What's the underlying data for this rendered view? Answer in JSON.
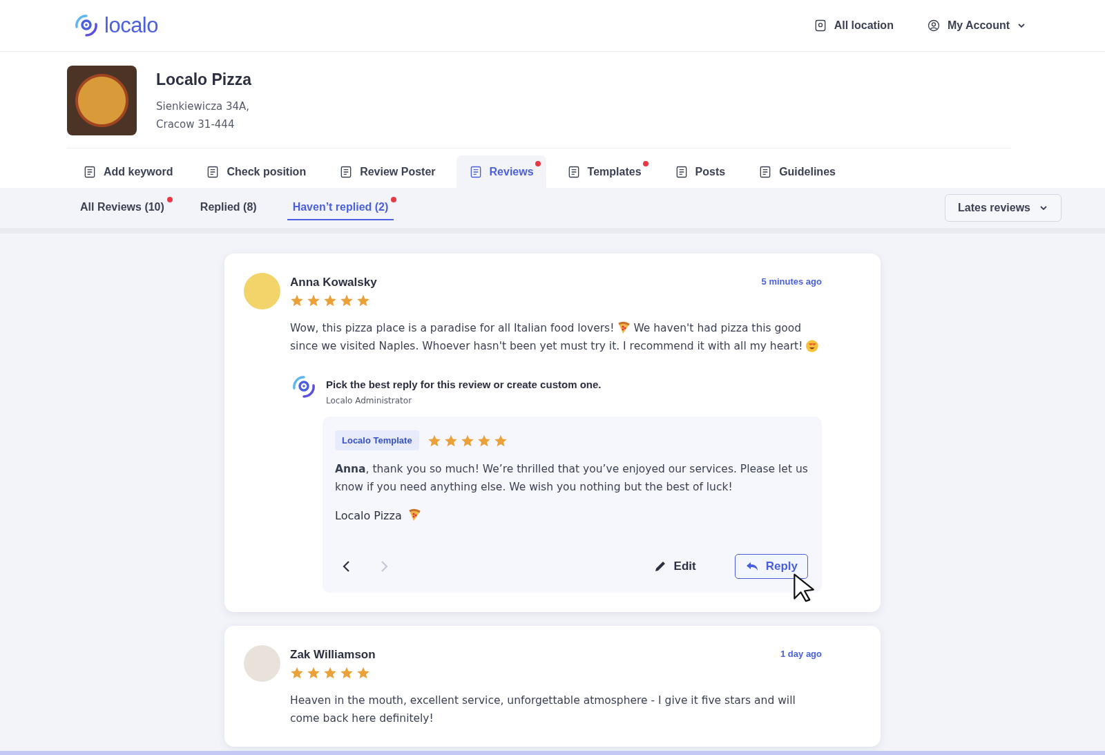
{
  "header": {
    "logo_text": "localo",
    "location_button": "All location",
    "account_button": "My Account"
  },
  "business": {
    "name": "Localo Pizza",
    "address_line_1": "Sienkiewicza 34A,",
    "address_line_2": "Cracow 31-444"
  },
  "tabs": [
    {
      "label": "Add keyword",
      "selected": false,
      "notification": false
    },
    {
      "label": "Check position",
      "selected": false,
      "notification": false
    },
    {
      "label": "Review Poster",
      "selected": false,
      "notification": false
    },
    {
      "label": "Reviews",
      "selected": true,
      "notification": true
    },
    {
      "label": "Templates",
      "selected": false,
      "notification": true
    },
    {
      "label": "Posts",
      "selected": false,
      "notification": false
    },
    {
      "label": "Guidelines",
      "selected": false,
      "notification": false
    }
  ],
  "filters": [
    {
      "label": "All Reviews (10)",
      "selected": false,
      "notification": true
    },
    {
      "label": "Replied (8)",
      "selected": false,
      "notification": false
    },
    {
      "label": "Haven’t replied (2)",
      "selected": true,
      "notification": true
    }
  ],
  "sort_dropdown": "Lates reviews",
  "reviews": [
    {
      "author": "Anna Kowalsky",
      "stars": 5,
      "time": "5 minutes ago",
      "body": [
        [
          {
            "kind": "text",
            "text": "Wow, this pizza place is a paradise for all Italian food lovers!"
          },
          {
            "kind": "pizza"
          },
          {
            "kind": "text",
            "text": "We haven't had pizza this good"
          }
        ],
        [
          {
            "kind": "text",
            "text": "since we visited Naples. Whoever hasn't been yet must try it. I recommend it with all my heart!"
          },
          {
            "kind": "love"
          }
        ]
      ],
      "suggestion": {
        "title": "Pick the best reply for this review or create custom one.",
        "subtitle": "Localo Administrator",
        "tag": "Localo Template",
        "stars": 5,
        "text": "**Anna**, thank you so much! We’re thrilled that you’ve enjoyed our services. Please let us know if you need anything else. We wish you nothing but the best of luck!",
        "signature": [
          {
            "kind": "text",
            "text": "Localo Pizza"
          },
          {
            "kind": "pizza"
          }
        ],
        "edit_button": "Edit",
        "reply_button": "Reply",
        "next_disabled": true
      }
    },
    {
      "author": "Zak Williamson",
      "stars": 5,
      "time": "1 day ago",
      "body": [
        [
          {
            "kind": "text",
            "text": "Heaven in the mouth, excellent service, unforgettable atmosphere - I give it five stars and will come back here definitely!"
          }
        ]
      ]
    }
  ]
}
